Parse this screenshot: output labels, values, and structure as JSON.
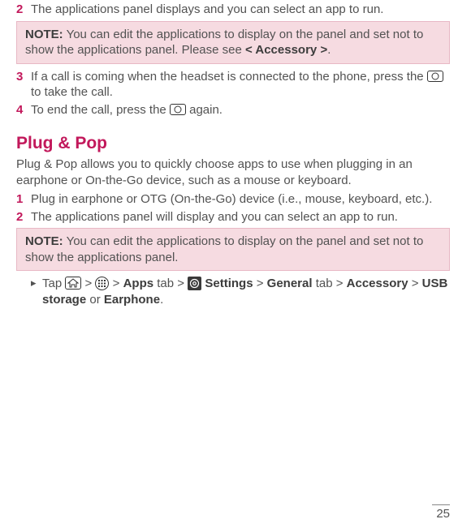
{
  "stepsA": [
    {
      "n": "2",
      "text": "The applications panel displays and you can select an app to run."
    }
  ],
  "noteA": {
    "label": "NOTE:",
    "body": " You can edit the applications to display on the panel and set not to show the applications panel. Please see ",
    "ref": "< Accessory >",
    "tail": "."
  },
  "stepsB": [
    {
      "n": "3",
      "pre": "If a call is coming when the headset is connected to the phone, press the ",
      "post": " to take the call."
    },
    {
      "n": "4",
      "pre": "To end the call, press the ",
      "post": " again."
    }
  ],
  "section": "Plug & Pop",
  "intro": "Plug & Pop allows you to quickly choose apps to use when plugging in an earphone or On-the-Go device, such as a mouse or keyboard.",
  "stepsC": [
    {
      "n": "1",
      "text": "Plug in earphone or OTG (On-the-Go) device (i.e., mouse, keyboard, etc.)."
    },
    {
      "n": "2",
      "text": "The applications panel will display and you can select an app to run."
    }
  ],
  "noteB": {
    "label": "NOTE:",
    "body": " You can edit the applications to display on the panel and set not to show the applications panel."
  },
  "tap": {
    "t1": "Tap ",
    "gt": " > ",
    "apps": "Apps",
    "tab": " tab > ",
    "settings": " Settings",
    "gt2": " > ",
    "general": "General",
    "acc": "Accessory ",
    "usb": "USB storage",
    "or": " or ",
    "ear": "Earphone",
    "end": "."
  },
  "bullet": "▸",
  "page": "25"
}
